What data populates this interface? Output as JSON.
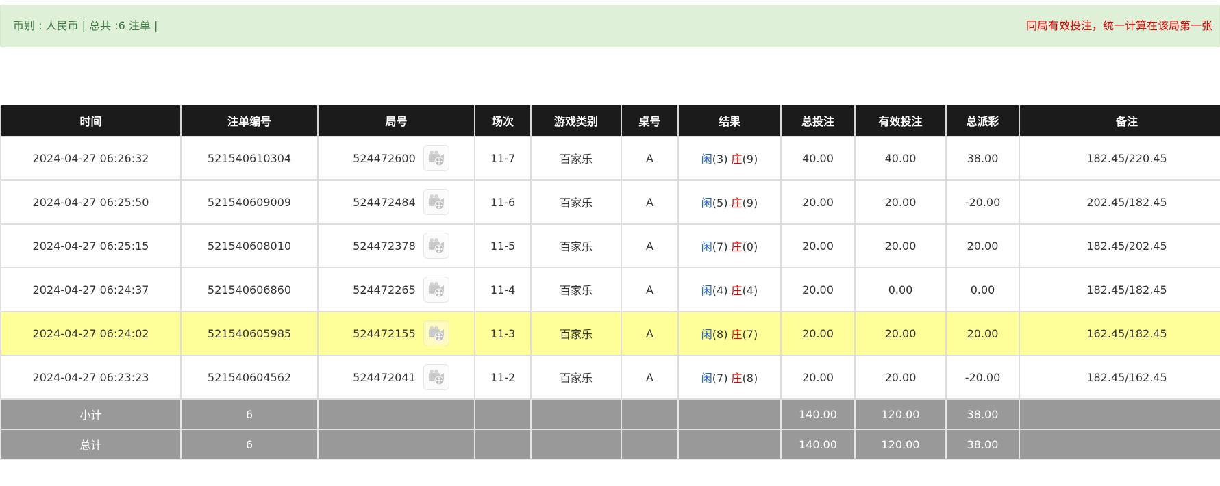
{
  "banner": {
    "left_text": "币别 : 人民币 | 总共 :6 注单 |",
    "right_text": "同局有效投注，统一计算在该局第一张"
  },
  "colors": {
    "banner_bg": "#dff0d8",
    "banner_text": "#3c763d",
    "header_bg": "#1b1b1b",
    "highlight_row": "#ffff99",
    "summary_row": "#999999",
    "blue": "#1e63d6",
    "red": "#e00000"
  },
  "table": {
    "headers": [
      "时间",
      "注单编号",
      "局号",
      "场次",
      "游戏类别",
      "桌号",
      "结果",
      "总投注",
      "有效投注",
      "总派彩",
      "备注"
    ],
    "rows": [
      {
        "time": "2024-04-27 06:26:32",
        "bet_id": "521540610304",
        "round": "524472600",
        "session": "11-7",
        "game": "百家乐",
        "table": "A",
        "player_label": "闲",
        "player_score": "(3)",
        "banker_label": "庄",
        "banker_score": "(9)",
        "total_bet": "40.00",
        "valid_bet": "40.00",
        "payout": "38.00",
        "payout_negative": false,
        "note": "182.45/220.45",
        "highlighted": false,
        "video_icon": "video-replay-icon"
      },
      {
        "time": "2024-04-27 06:25:50",
        "bet_id": "521540609009",
        "round": "524472484",
        "session": "11-6",
        "game": "百家乐",
        "table": "A",
        "player_label": "闲",
        "player_score": "(5)",
        "banker_label": "庄",
        "banker_score": "(9)",
        "total_bet": "20.00",
        "valid_bet": "20.00",
        "payout": "-20.00",
        "payout_negative": true,
        "note": "202.45/182.45",
        "highlighted": false,
        "video_icon": "video-replay-icon"
      },
      {
        "time": "2024-04-27 06:25:15",
        "bet_id": "521540608010",
        "round": "524472378",
        "session": "11-5",
        "game": "百家乐",
        "table": "A",
        "player_label": "闲",
        "player_score": "(7)",
        "banker_label": "庄",
        "banker_score": "(0)",
        "total_bet": "20.00",
        "valid_bet": "20.00",
        "payout": "20.00",
        "payout_negative": false,
        "note": "182.45/202.45",
        "highlighted": false,
        "video_icon": "video-replay-icon"
      },
      {
        "time": "2024-04-27 06:24:37",
        "bet_id": "521540606860",
        "round": "524472265",
        "session": "11-4",
        "game": "百家乐",
        "table": "A",
        "player_label": "闲",
        "player_score": "(4)",
        "banker_label": "庄",
        "banker_score": "(4)",
        "total_bet": "20.00",
        "valid_bet": "0.00",
        "payout": "0.00",
        "payout_negative": false,
        "note": "182.45/182.45",
        "highlighted": false,
        "video_icon": "video-replay-icon"
      },
      {
        "time": "2024-04-27 06:24:02",
        "bet_id": "521540605985",
        "round": "524472155",
        "session": "11-3",
        "game": "百家乐",
        "table": "A",
        "player_label": "闲",
        "player_score": "(8)",
        "banker_label": "庄",
        "banker_score": "(7)",
        "total_bet": "20.00",
        "valid_bet": "20.00",
        "payout": "20.00",
        "payout_negative": false,
        "note": "162.45/182.45",
        "highlighted": true,
        "video_icon": "video-replay-icon"
      },
      {
        "time": "2024-04-27 06:23:23",
        "bet_id": "521540604562",
        "round": "524472041",
        "session": "11-2",
        "game": "百家乐",
        "table": "A",
        "player_label": "闲",
        "player_score": "(7)",
        "banker_label": "庄",
        "banker_score": "(8)",
        "total_bet": "20.00",
        "valid_bet": "20.00",
        "payout": "-20.00",
        "payout_negative": true,
        "note": "182.45/162.45",
        "highlighted": false,
        "video_icon": "video-replay-icon"
      }
    ],
    "subtotal": {
      "label": "小计",
      "count": "6",
      "total_bet": "140.00",
      "valid_bet": "120.00",
      "payout": "38.00"
    },
    "grand_total": {
      "label": "总计",
      "count": "6",
      "total_bet": "140.00",
      "valid_bet": "120.00",
      "payout": "38.00"
    }
  }
}
